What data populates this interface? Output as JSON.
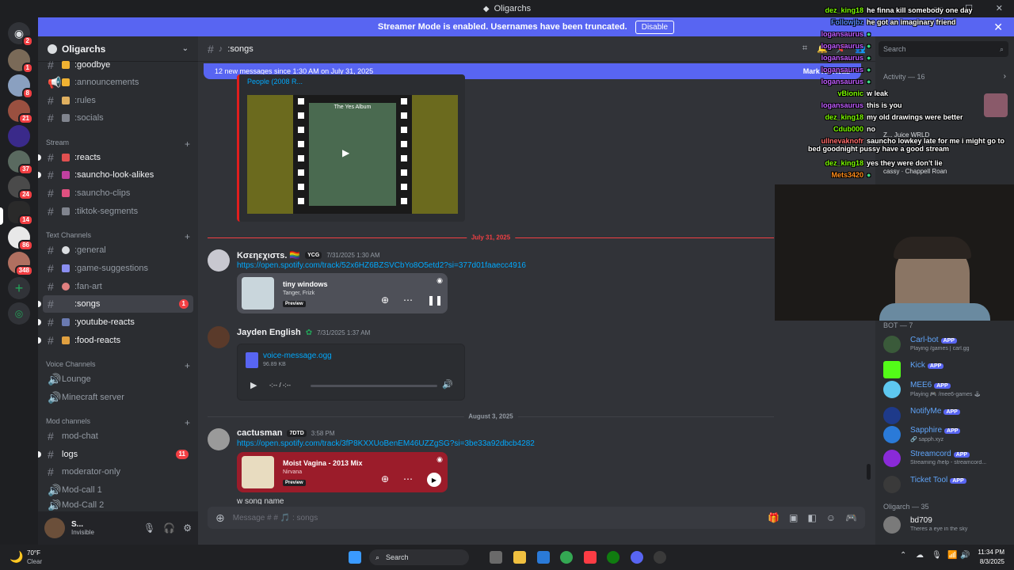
{
  "window": {
    "title": "Oligarchs"
  },
  "banner": {
    "text": "Streamer Mode is enabled. Usernames have been truncated.",
    "button": "Disable"
  },
  "server": {
    "name": "Oligarchs"
  },
  "rail": {
    "badges": [
      "2",
      "1",
      "8",
      "21",
      "37",
      "24",
      "14",
      "86",
      "348"
    ]
  },
  "sidebar": {
    "top_channels": [
      ":goodbye",
      ":announcements",
      ":rules",
      ":socials"
    ],
    "stream_category": "Stream",
    "stream_channels": [
      ":reacts",
      ":sauncho-look-alikes",
      ":sauncho-clips",
      ":tiktok-segments"
    ],
    "text_category": "Text Channels",
    "text_channels": [
      ":general",
      ":game-suggestions",
      ":fan-art",
      ":songs",
      ":youtube-reacts",
      ":food-reacts"
    ],
    "songs_badge": "1",
    "voice_category": "Voice Channels",
    "voice_channels": [
      "Lounge",
      "Minecraft server"
    ],
    "mod_category": "Mod channels",
    "mod_channels": [
      "mod-chat",
      "logs",
      "moderator-only",
      "Mod-call 1",
      "Mod-Call 2"
    ],
    "logs_badge": "11"
  },
  "user": {
    "name": "S...",
    "status": "Invisible"
  },
  "channel": {
    "name": ":songs",
    "hash": "#"
  },
  "newbar": {
    "text": "12 new messages since 1:30 AM on July 31, 2025",
    "action": "Mark As Read"
  },
  "messages": {
    "prev_embed_title": "People (2008 R...",
    "album_title": "The Yes Album",
    "date1": "July 31, 2025",
    "m1": {
      "name": "Κσεηεχιστs. 🏳️‍🌈",
      "tag": "YCG",
      "time": "7/31/2025 1:30 AM",
      "link": "https://open.spotify.com/track/52x6HZ6BZSVCbYo8O5etd2?si=377d01faaecc4916",
      "track": "tiny windows",
      "artist": "Tanger, Frizk",
      "preview": "Preview"
    },
    "m2": {
      "name": "Jayden English",
      "time": "7/31/2025 1:37 AM",
      "file": "voice-message.ogg",
      "size": "96.89 KB",
      "player_time": "-:-- / -:--"
    },
    "date2": "August 3, 2025",
    "m3": {
      "name": "cactusman",
      "tag": "7DTD",
      "time": "3:58 PM",
      "link": "https://open.spotify.com/track/3fP8KXXUoBenEM46UZZgSG?si=3be33a92dbcb4282",
      "track": "Moist Vagina - 2013 Mix",
      "artist": "Nirvana",
      "preview": "Preview",
      "text": "w song name"
    }
  },
  "composer": {
    "placeholder": "Message # # 🎵 : songs"
  },
  "right": {
    "search": "Search",
    "activity": "Activity — 16",
    "activity_items": [
      {
        "name": "Juice WRLD",
        "status": "Z..."
      },
      {
        "name": "cassy",
        "status": "Chappell Roan"
      }
    ],
    "bot_header": "BOT — 7",
    "bots": [
      {
        "name": "Carl-bot",
        "app": "APP",
        "status": "Playing /games | carl.gg",
        "color": "#60a5fa"
      },
      {
        "name": "Kick",
        "app": "APP",
        "status": "",
        "color": "#53fc18"
      },
      {
        "name": "MEE6",
        "app": "APP",
        "status": "Playing 🎮 /mee6-games 🕹",
        "color": "#60a5fa"
      },
      {
        "name": "NotifyMe",
        "app": "APP",
        "status": "",
        "color": "#60a5fa"
      },
      {
        "name": "Sapphire",
        "app": "APP",
        "status": "🔗 sapph.xyz",
        "color": "#60a5fa"
      },
      {
        "name": "Streamcord",
        "app": "APP",
        "status": "Streaming /help - streamcord...",
        "color": "#60a5fa"
      },
      {
        "name": "Ticket Tool",
        "app": "APP",
        "status": "",
        "color": "#60a5fa"
      }
    ],
    "olig_header": "Oligarch — 35",
    "olig_member": {
      "name": "bd709",
      "status": "Theres a eye in the sky"
    }
  },
  "overlay": [
    {
      "u": "dez_king18",
      "t": "he finna kill somebody one day",
      "c": "#7CFC00"
    },
    {
      "u": "Followjbz",
      "t": "he got an imaginary friend",
      "c": "#5b8cff"
    },
    {
      "u": "logansaurus",
      "t": "",
      "c": "#c05cff"
    },
    {
      "u": "logansaurus",
      "t": "",
      "c": "#c05cff"
    },
    {
      "u": "logansaurus",
      "t": "",
      "c": "#c05cff"
    },
    {
      "u": "logansaurus",
      "t": "",
      "c": "#c05cff"
    },
    {
      "u": "logansaurus",
      "t": "",
      "c": "#c05cff"
    },
    {
      "u": "vBionic",
      "t": "w leak",
      "c": "#7CFC00"
    },
    {
      "u": "logansaurus",
      "t": "this is you",
      "c": "#c05cff"
    },
    {
      "u": "dez_king18",
      "t": "my old drawings were better",
      "c": "#7CFC00"
    },
    {
      "u": "Cdub000",
      "t": "no",
      "c": "#7CFC00"
    },
    {
      "u": "ullnevaknofr",
      "t": "sauncho lowkey late for me i might go to bed goodnight pussy have a good stream",
      "c": "#ff6b6b"
    },
    {
      "u": "dez_king18",
      "t": "yes they were don't lie",
      "c": "#7CFC00"
    },
    {
      "u": "Mets3420",
      "t": "",
      "c": "#ff8c1a"
    }
  ],
  "taskbar": {
    "weather_temp": "70°F",
    "weather_desc": "Clear",
    "search": "Search",
    "time": "11:34 PM",
    "date": "8/3/2025"
  }
}
